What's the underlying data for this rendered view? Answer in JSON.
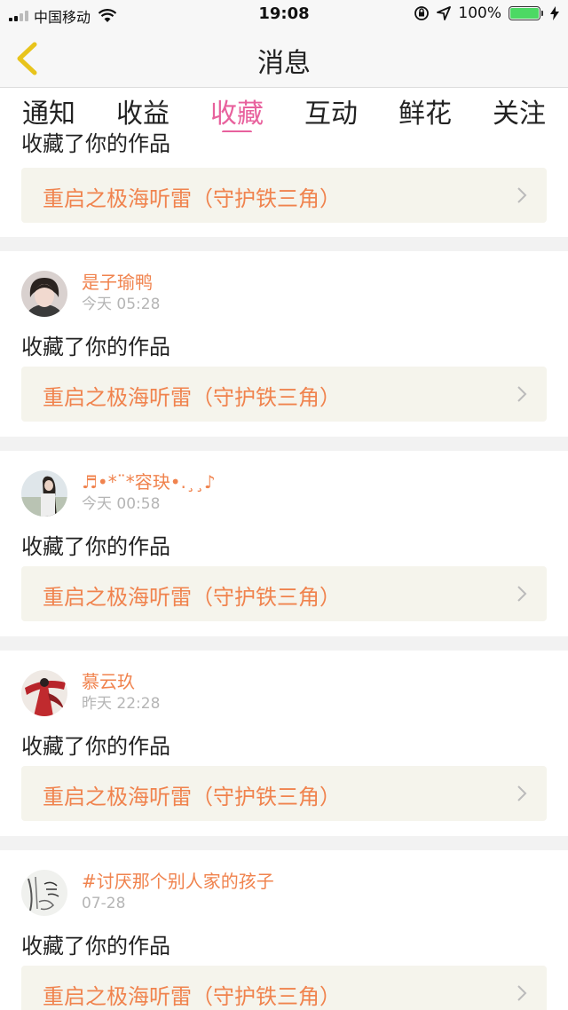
{
  "status_bar": {
    "carrier": "中国移动",
    "time": "19:08",
    "battery": "100%",
    "icons": [
      "signal-icon",
      "wifi-icon",
      "rotation-lock-icon",
      "location-icon",
      "battery-icon",
      "charging-icon"
    ],
    "battery_color": "#4cd964"
  },
  "nav": {
    "title": "消息",
    "back_icon": "chevron-left-icon",
    "back_icon_color": "#e8c41c"
  },
  "tabs": [
    {
      "label": "通知",
      "active": false
    },
    {
      "label": "收益",
      "active": false
    },
    {
      "label": "收藏",
      "active": true
    },
    {
      "label": "互动",
      "active": false
    },
    {
      "label": "鲜花",
      "active": false
    },
    {
      "label": "关注",
      "active": false
    }
  ],
  "colors": {
    "accent": "#e8619d",
    "username": "#f0834e",
    "work_box_bg": "#f5f4ec",
    "separator": "#f2f2f2"
  },
  "partial_item": {
    "action": "收藏了你的作品",
    "work_title": "重启之极海听雷（守护铁三角）"
  },
  "items": [
    {
      "username": "是子瑜鸭",
      "time": "今天 05:28",
      "action": "收藏了你的作品",
      "work_title": "重启之极海听雷（守护铁三角）"
    },
    {
      "username": "♬•*¨*容玦•.¸¸♪",
      "time": "今天 00:58",
      "action": "收藏了你的作品",
      "work_title": "重启之极海听雷（守护铁三角）"
    },
    {
      "username": "慕云玖",
      "time": "昨天 22:28",
      "action": "收藏了你的作品",
      "work_title": "重启之极海听雷（守护铁三角）"
    },
    {
      "username": "#讨厌那个别人家的孩子",
      "time": "07-28",
      "action": "收藏了你的作品",
      "work_title": "重启之极海听雷（守护铁三角）"
    }
  ]
}
